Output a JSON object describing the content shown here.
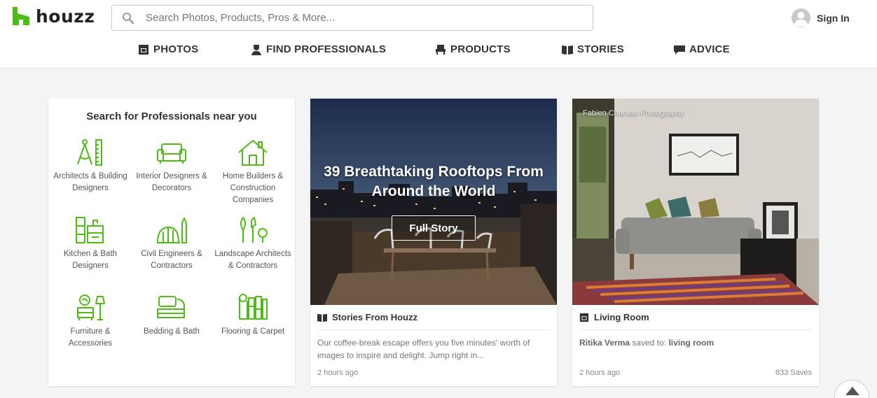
{
  "brand": {
    "name": "houzz",
    "color": "#4dbc15"
  },
  "search": {
    "placeholder": "Search Photos, Products, Pros & More..."
  },
  "account": {
    "sign_in_label": "Sign In"
  },
  "nav": {
    "items": [
      {
        "label": "PHOTOS",
        "icon": "photos-icon"
      },
      {
        "label": "FIND PROFESSIONALS",
        "icon": "professional-icon"
      },
      {
        "label": "PRODUCTS",
        "icon": "products-icon"
      },
      {
        "label": "STORIES",
        "icon": "stories-icon"
      },
      {
        "label": "ADVICE",
        "icon": "advice-icon"
      }
    ]
  },
  "pros": {
    "title": "Search for Professionals near you",
    "categories": [
      {
        "label": "Architects & Building Designers",
        "icon": "architect-icon"
      },
      {
        "label": "Interior Designers & Decorators",
        "icon": "sofa-icon"
      },
      {
        "label": "Home Builders & Construction Companies",
        "icon": "house-icon"
      },
      {
        "label": "Kitchen & Bath Designers",
        "icon": "kitchen-icon"
      },
      {
        "label": "Civil Engineers & Contractors",
        "icon": "engineer-icon"
      },
      {
        "label": "Landscape Architects & Contractors",
        "icon": "landscape-icon"
      },
      {
        "label": "Furniture & Accessories",
        "icon": "furniture-icon"
      },
      {
        "label": "Bedding & Bath",
        "icon": "bedding-icon"
      },
      {
        "label": "Flooring & Carpet",
        "icon": "flooring-icon"
      }
    ]
  },
  "story_card": {
    "headline": "39 Breathtaking Rooftops From Around the World",
    "button_label": "Full Story",
    "section_label": "Stories From Houzz",
    "description": "Our coffee-break escape offers you five minutes' worth of images to inspire and delight. Jump right in...",
    "time": "2 hours ago"
  },
  "photo_card": {
    "credit": "Fabien Charuau Photography",
    "section_label": "Living Room",
    "user": "Ritika Verma",
    "saved_to_text": "saved to:",
    "board": "living room",
    "time": "2 hours ago",
    "saves": "833 Saves"
  }
}
